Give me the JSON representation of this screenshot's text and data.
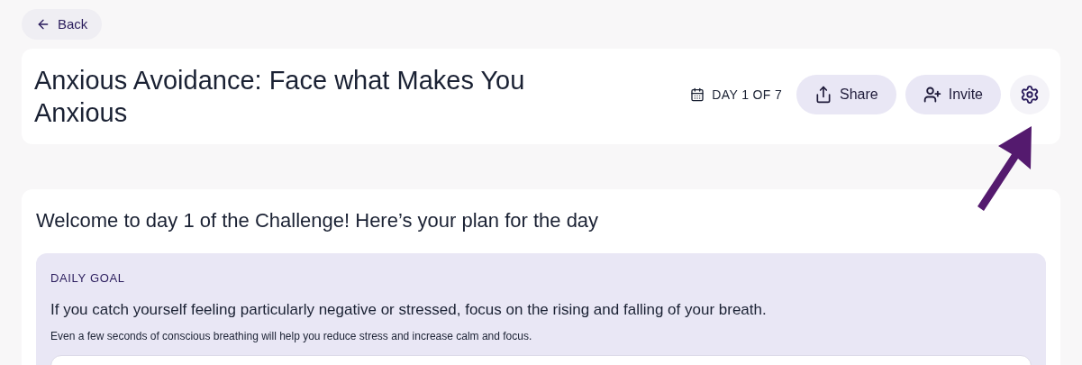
{
  "back_button": {
    "label": "Back"
  },
  "header": {
    "title": "Anxious Avoidance: Face what Makes You Anxious",
    "progress": "DAY 1 OF 7",
    "buttons": [
      {
        "kind": "share",
        "label": "Share"
      },
      {
        "kind": "invite",
        "label": "Invite"
      },
      {
        "kind": "settings"
      }
    ]
  },
  "plan": {
    "heading": "Welcome to day 1 of the Challenge! Here’s your plan for the day",
    "daily_goal": {
      "label": "DAILY GOAL",
      "goal": "If you catch yourself feeling particularly negative or stressed, focus on the rising and falling of your breath.",
      "note": "Even a few seconds of conscious breathing will help you reduce stress and increase calm and focus."
    }
  }
}
